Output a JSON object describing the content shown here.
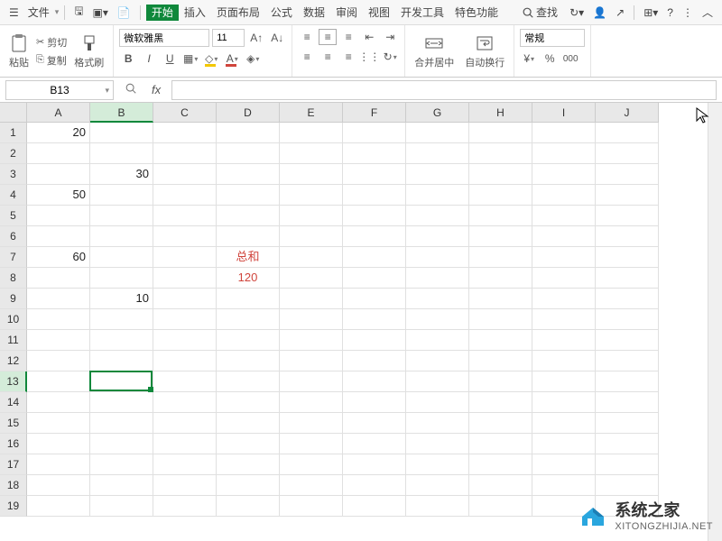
{
  "menubar": {
    "file": "文件",
    "tabs": [
      "开始",
      "插入",
      "页面布局",
      "公式",
      "数据",
      "审阅",
      "视图",
      "开发工具",
      "特色功能"
    ],
    "activeTab": 0,
    "search": "查找"
  },
  "ribbon": {
    "paste": "粘贴",
    "cut": "剪切",
    "copy": "复制",
    "formatPainter": "格式刷",
    "font": "微软雅黑",
    "fontSize": "11",
    "mergeCenter": "合并居中",
    "wrapText": "自动换行",
    "numFormat": "常规"
  },
  "formulaBar": {
    "cellRef": "B13",
    "value": ""
  },
  "grid": {
    "columns": [
      "A",
      "B",
      "C",
      "D",
      "E",
      "F",
      "G",
      "H",
      "I",
      "J"
    ],
    "rowCount": 19,
    "selected": {
      "row": 13,
      "col": 2
    },
    "cells": {
      "A1": {
        "v": "20"
      },
      "B3": {
        "v": "30"
      },
      "A4": {
        "v": "50"
      },
      "A7": {
        "v": "60"
      },
      "D7": {
        "v": "总和",
        "cls": "red"
      },
      "D8": {
        "v": "120",
        "cls": "red"
      },
      "B9": {
        "v": "10"
      }
    }
  },
  "watermark": {
    "cn": "系统之家",
    "en": "XITONGZHIJIA.NET"
  }
}
